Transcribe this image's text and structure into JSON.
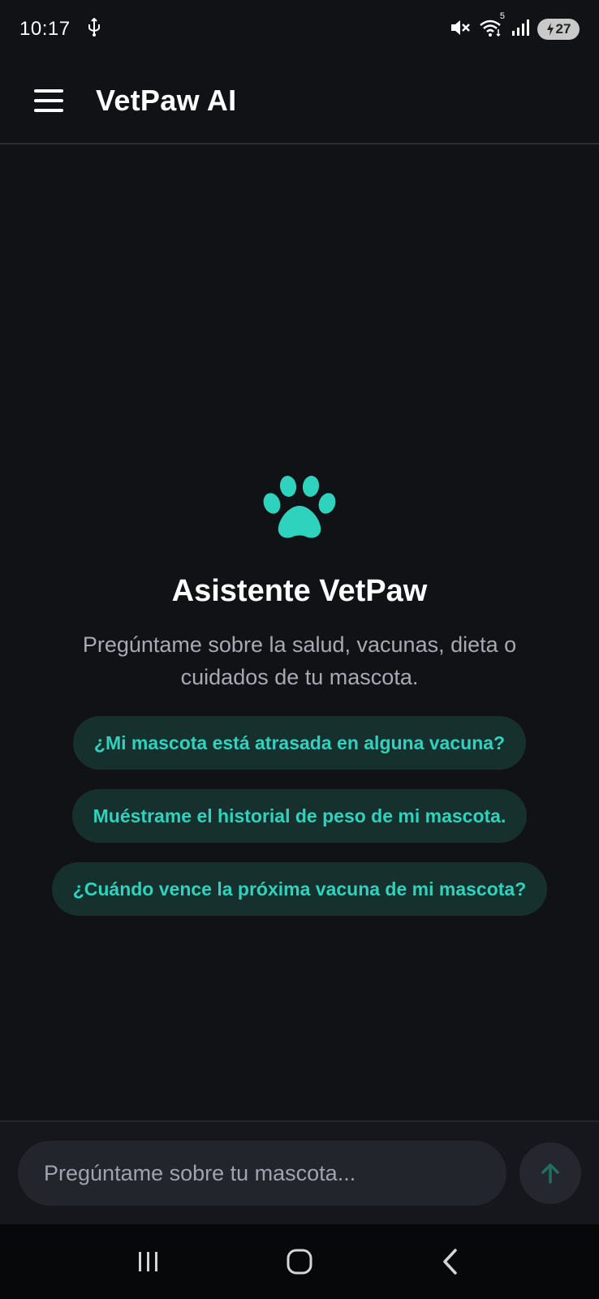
{
  "status_bar": {
    "time": "10:17",
    "battery_level": "27",
    "wifi_badge": "5",
    "icons": [
      "usb-icon",
      "mute-icon",
      "wifi-icon",
      "signal-icon",
      "battery-icon"
    ]
  },
  "app_bar": {
    "title": "VetPaw AI",
    "menu_icon": "hamburger-menu-icon"
  },
  "empty_state": {
    "icon": "paw-icon",
    "icon_color": "#2fd3bd",
    "title": "Asistente VetPaw",
    "description": "Pregúntame sobre la salud, vacunas, dieta o cuidados de tu mascota.",
    "suggestions": [
      "¿Mi mascota está atrasada en alguna vacuna?",
      "Muéstrame el historial de peso de mi mascota.",
      "¿Cuándo vence la próxima vacuna de mi mascota?"
    ]
  },
  "composer": {
    "placeholder": "Pregúntame sobre tu mascota...",
    "value": "",
    "send_icon": "arrow-up-icon"
  },
  "nav_bar": {
    "icons": [
      "recents-icon",
      "home-icon",
      "back-icon"
    ]
  },
  "colors": {
    "background": "#111216",
    "accent": "#2fd3bd",
    "chip_background": "#16302d"
  }
}
